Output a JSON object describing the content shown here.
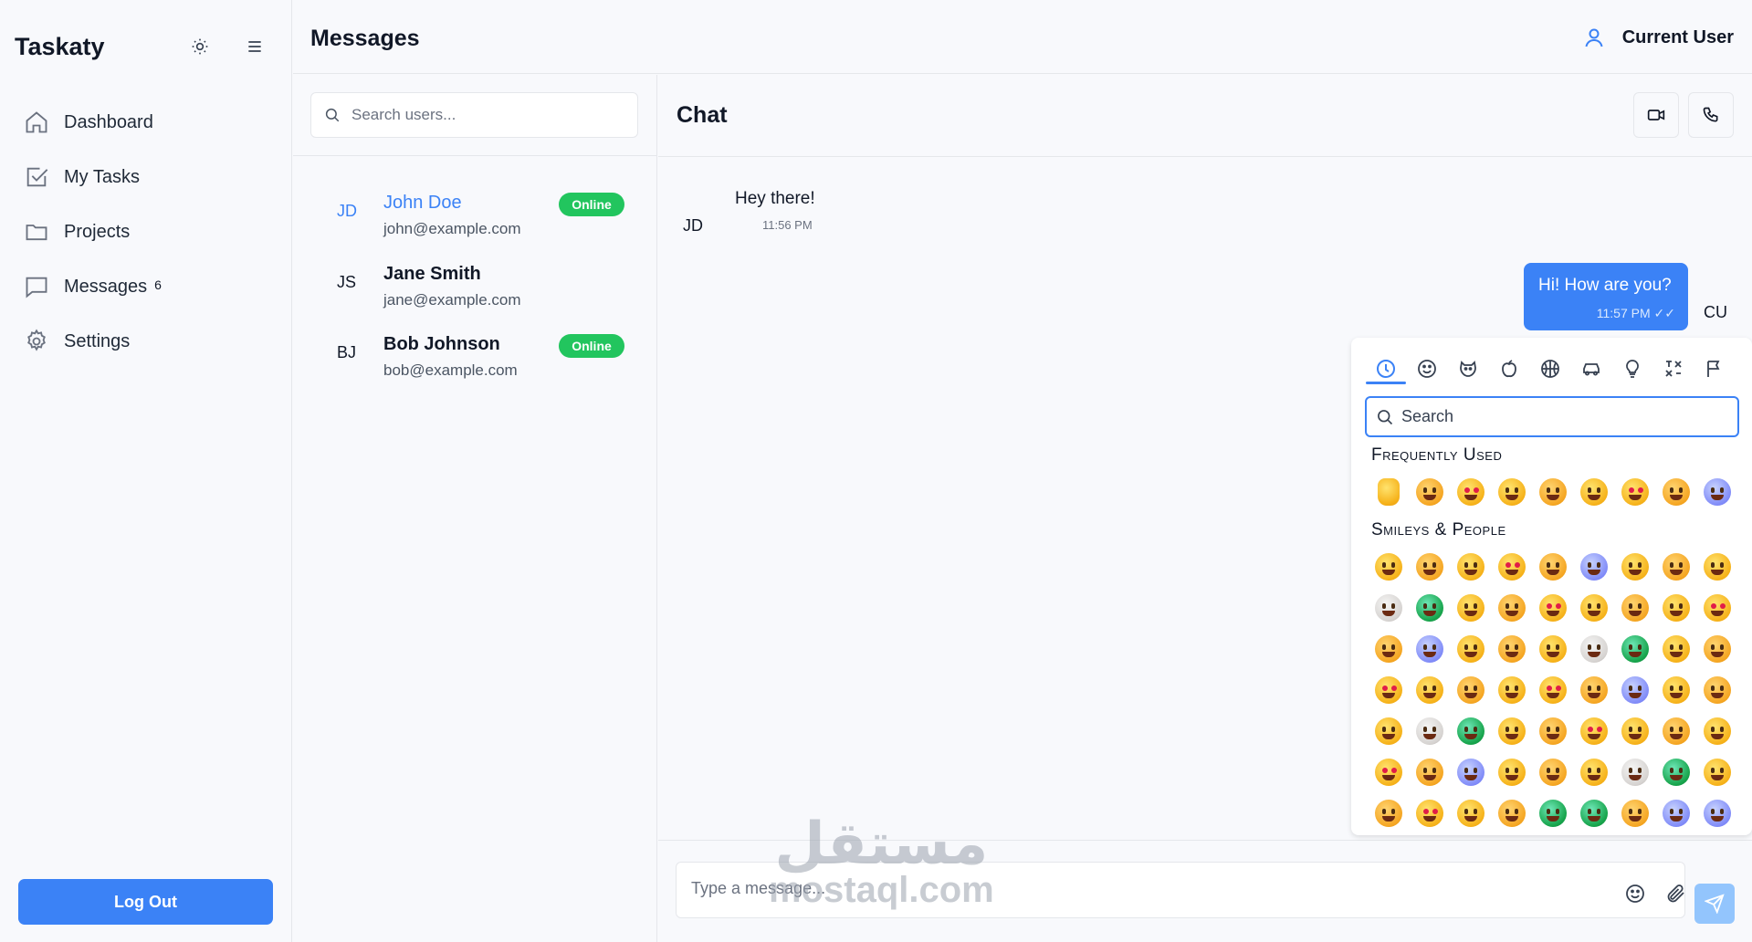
{
  "sidebar": {
    "brand": "Taskaty",
    "items": [
      {
        "label": "Dashboard",
        "icon": "home-icon"
      },
      {
        "label": "My Tasks",
        "icon": "checkbox-icon"
      },
      {
        "label": "Projects",
        "icon": "folder-icon"
      },
      {
        "label": "Messages",
        "icon": "message-icon",
        "badge": "6"
      },
      {
        "label": "Settings",
        "icon": "gear-icon"
      }
    ],
    "logout_label": "Log Out"
  },
  "header": {
    "title": "Messages",
    "user_name": "Current User"
  },
  "users": {
    "search_placeholder": "Search users...",
    "list": [
      {
        "initials": "JD",
        "name": "John Doe",
        "email": "john@example.com",
        "status": "Online",
        "active": true
      },
      {
        "initials": "JS",
        "name": "Jane Smith",
        "email": "jane@example.com",
        "status": "",
        "active": false
      },
      {
        "initials": "BJ",
        "name": "Bob Johnson",
        "email": "bob@example.com",
        "status": "Online",
        "active": false
      }
    ]
  },
  "chat": {
    "title": "Chat",
    "messages": [
      {
        "from": "JD",
        "text": "Hey there!",
        "time": "11:56 PM",
        "direction": "in"
      },
      {
        "from": "CU",
        "text": "Hi! How are you?",
        "time": "11:57 PM ✓✓",
        "direction": "out"
      }
    ],
    "input_placeholder": "Type a message..."
  },
  "emoji_picker": {
    "search_placeholder": "Search",
    "tabs": [
      "recent-icon",
      "smiley-icon",
      "animal-icon",
      "food-icon",
      "ball-icon",
      "car-icon",
      "bulb-icon",
      "symbols-icon",
      "flag-icon"
    ],
    "categories": [
      {
        "title": "Frequently Used",
        "count": 9
      },
      {
        "title": "Smileys & People",
        "count": 63
      }
    ]
  },
  "watermark": {
    "arabic": "مستقل",
    "latin": "mostaql.com"
  },
  "colors": {
    "accent": "#3b82f6",
    "online": "#22c55e",
    "send_button": "#93c5fd"
  }
}
